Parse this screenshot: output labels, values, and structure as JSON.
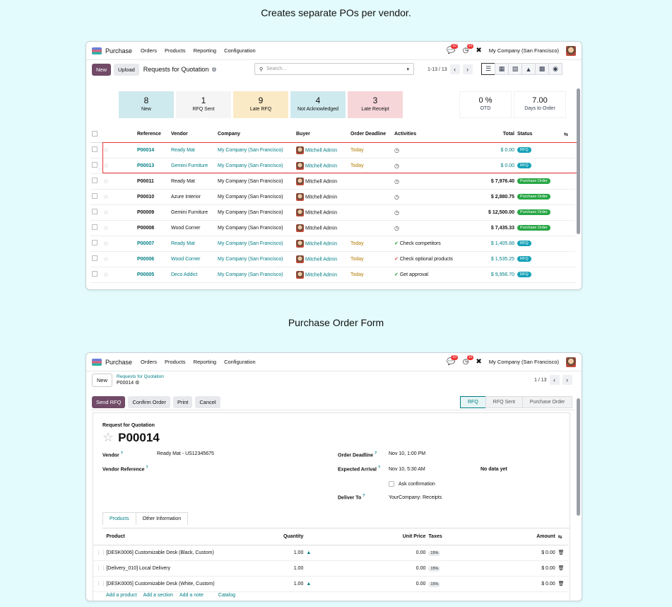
{
  "captions": {
    "top": "Creates separate POs per vendor.",
    "bottom": "Purchase Order Form"
  },
  "navbar": {
    "app": "Purchase",
    "menus": [
      "Orders",
      "Products",
      "Reporting",
      "Configuration"
    ],
    "messages_badge": "10",
    "activities_badge": "10",
    "company": "My Company (San Francisco)"
  },
  "list": {
    "new_label": "New",
    "upload_label": "Upload",
    "breadcrumb": "Requests for Quotation",
    "search_placeholder": "Search...",
    "pager": "1-13 / 13",
    "cards": [
      {
        "n": "8",
        "l": "New",
        "color": "#cfeaee"
      },
      {
        "n": "1",
        "l": "RFQ Sent",
        "color": "#f5f5f5"
      },
      {
        "n": "9",
        "l": "Late RFQ",
        "color": "#fbeac6"
      },
      {
        "n": "4",
        "l": "Not Acknowledged",
        "color": "#cfeaee"
      },
      {
        "n": "3",
        "l": "Late Receipt",
        "color": "#f6d6d9"
      }
    ],
    "kpis": [
      {
        "n": "0 %",
        "l": "OTD"
      },
      {
        "n": "7.00",
        "l": "Days to Order"
      }
    ],
    "columns": [
      "Reference",
      "Vendor",
      "Company",
      "Buyer",
      "Order Deadline",
      "Activities",
      "Total",
      "Status"
    ],
    "rows": [
      {
        "ref": "P00014",
        "vendor": "Ready Mat",
        "company": "My Company (San Francisco)",
        "buyer": "Mitchell Admin",
        "deadline": "Today",
        "activity": "",
        "total": "$ 0.00",
        "status": "RFQ"
      },
      {
        "ref": "P00013",
        "vendor": "Gemini Furniture",
        "company": "My Company (San Francisco)",
        "buyer": "Mitchell Admin",
        "deadline": "Today",
        "activity": "",
        "total": "$ 0.00",
        "status": "RFQ"
      },
      {
        "ref": "P00011",
        "vendor": "Ready Mat",
        "company": "My Company (San Francisco)",
        "buyer": "Mitchell Admin",
        "deadline": "",
        "activity": "",
        "total": "$ 7,976.40",
        "status": "Purchase Order"
      },
      {
        "ref": "P00010",
        "vendor": "Azure Interior",
        "company": "My Company (San Francisco)",
        "buyer": "Mitchell Admin",
        "deadline": "",
        "activity": "",
        "total": "$ 2,880.75",
        "status": "Purchase Order"
      },
      {
        "ref": "P00009",
        "vendor": "Gemini Furniture",
        "company": "My Company (San Francisco)",
        "buyer": "Mitchell Admin",
        "deadline": "",
        "activity": "",
        "total": "$ 12,500.00",
        "status": "Purchase Order"
      },
      {
        "ref": "P00008",
        "vendor": "Wood Corner",
        "company": "My Company (San Francisco)",
        "buyer": "Mitchell Admin",
        "deadline": "",
        "activity": "",
        "total": "$ 7,435.33",
        "status": "Purchase Order"
      },
      {
        "ref": "P00007",
        "vendor": "Ready Mat",
        "company": "My Company (San Francisco)",
        "buyer": "Mitchell Admin",
        "deadline": "Today",
        "activity": "Check competitors",
        "total": "$ 1,405.88",
        "status": "RFQ"
      },
      {
        "ref": "P00006",
        "vendor": "Wood Corner",
        "company": "My Company (San Francisco)",
        "buyer": "Mitchell Admin",
        "deadline": "Today",
        "activity": "Check optional products",
        "total": "$ 1,535.25",
        "status": "RFQ"
      },
      {
        "ref": "P00005",
        "vendor": "Deco Addict",
        "company": "My Company (San Francisco)",
        "buyer": "Mitchell Admin",
        "deadline": "Today",
        "activity": "Get approval",
        "total": "$ 9,956.70",
        "status": "RFQ"
      }
    ]
  },
  "form": {
    "new_label": "New",
    "breadcrumb_parent": "Requests for Quotation",
    "breadcrumb_current": "P00014",
    "pager": "1 / 13",
    "buttons": [
      "Send RFQ",
      "Confirm Order",
      "Print",
      "Cancel"
    ],
    "statuses": [
      "RFQ",
      "RFQ Sent",
      "Purchase Order"
    ],
    "doc_type": "Request for Quotation",
    "doc_ref": "P00014",
    "vendor_label": "Vendor",
    "vendor_value": "Ready Mat - US12345675",
    "vendor_ref_label": "Vendor Reference",
    "deadline_label": "Order Deadline",
    "deadline_value": "Nov 10, 1:00 PM",
    "expected_label": "Expected Arrival",
    "expected_value": "Nov 10, 5:30 AM",
    "no_data": "No data yet",
    "ask_confirmation": "Ask confirmation",
    "deliver_label": "Deliver To",
    "deliver_value": "YourCompany: Receipts",
    "tabs": [
      "Products",
      "Other Information"
    ],
    "line_columns": [
      "Product",
      "Quantity",
      "Unit Price",
      "Taxes",
      "Amount"
    ],
    "lines": [
      {
        "product": "[DESK0006] Customizable Desk (Black, Custom)",
        "qty": "1.00",
        "price": "0.00",
        "tax": "15%",
        "amount": "$ 0.00"
      },
      {
        "product": "[Delivery_010] Local Delivery",
        "qty": "1.00",
        "price": "0.00",
        "tax": "15%",
        "amount": "$ 0.00"
      },
      {
        "product": "[DESK0005] Customizable Desk (White, Custom)",
        "qty": "1.00",
        "price": "0.00",
        "tax": "15%",
        "amount": "$ 0.00"
      }
    ],
    "add_links": [
      "Add a product",
      "Add a section",
      "Add a note",
      "Catalog"
    ]
  }
}
